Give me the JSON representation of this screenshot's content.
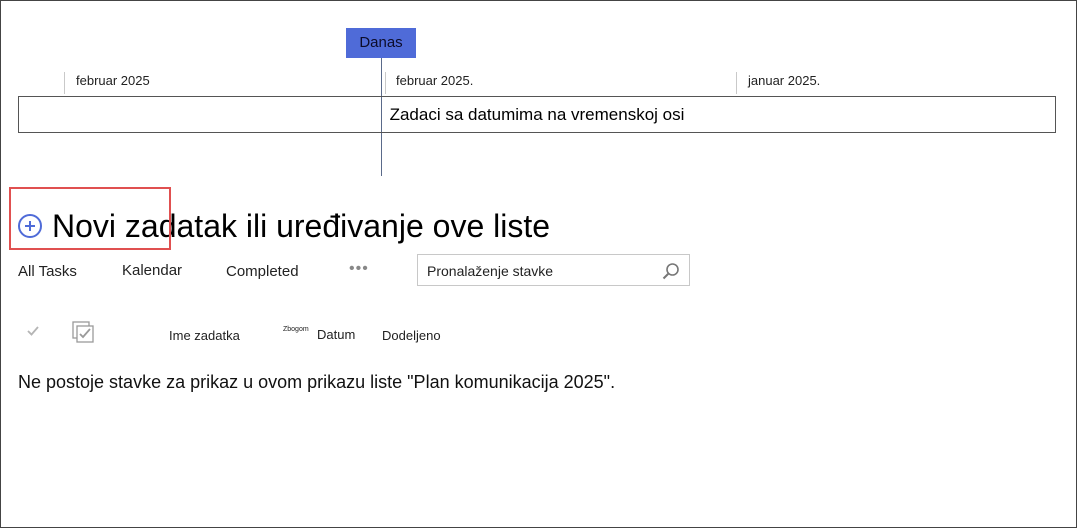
{
  "timeline": {
    "today_label": "Danas",
    "ticks": [
      {
        "label": "februar 2025"
      },
      {
        "label": "februar 2025."
      },
      {
        "label": "januar 2025."
      }
    ],
    "bar_text": "Zadaci sa datumima na vremenskoj osi"
  },
  "new_task": {
    "label": "Novi zadatak ili uređivanje ove liste",
    "icon": "plus-circle-icon"
  },
  "views": [
    {
      "label": "All Tasks"
    },
    {
      "label": "Kalendar"
    },
    {
      "label": "Completed"
    }
  ],
  "more_label": "•••",
  "search": {
    "placeholder": "Pronalaženje stavke",
    "icon": "search-icon"
  },
  "columns": {
    "task_name": "Ime zadatka",
    "small_prefix": "Zbogom",
    "date": "Datum",
    "assigned": "Dodeljeno"
  },
  "empty_message": "Ne postoje stavke za prikaz u ovom prikazu liste \"Plan komunikacija 2025\".",
  "colors": {
    "accent": "#4f6bd8",
    "highlight": "#e05050"
  }
}
